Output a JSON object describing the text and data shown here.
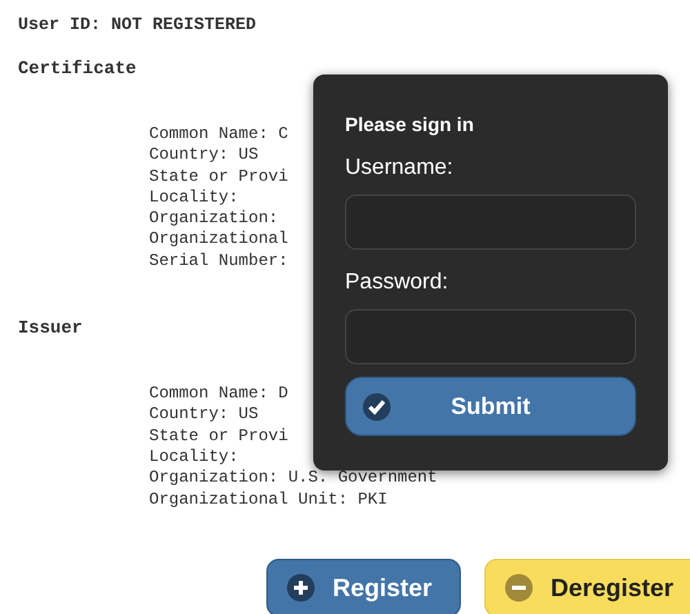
{
  "user_id": "User ID: NOT REGISTERED",
  "sections": [
    {
      "heading": "Certificate",
      "lines": [
        "Common Name: C",
        "Country: US",
        "State or Provi",
        "Locality:",
        "Organization:",
        "Organizational",
        "Serial Number:"
      ]
    },
    {
      "heading": "Issuer",
      "lines": [
        "Common Name: D",
        "Country: US",
        "State or Provi",
        "Locality:",
        "Organization: U.S. Government",
        "Organizational Unit: PKI"
      ]
    }
  ],
  "sign_in": {
    "title": "Please sign in",
    "fields": [
      {
        "label": "Username:"
      },
      {
        "label": "Password:"
      }
    ],
    "submit": "Submit"
  },
  "buttons": [
    {
      "label": "Register",
      "kind": "register"
    },
    {
      "label": "Deregister",
      "kind": "deregister"
    }
  ]
}
